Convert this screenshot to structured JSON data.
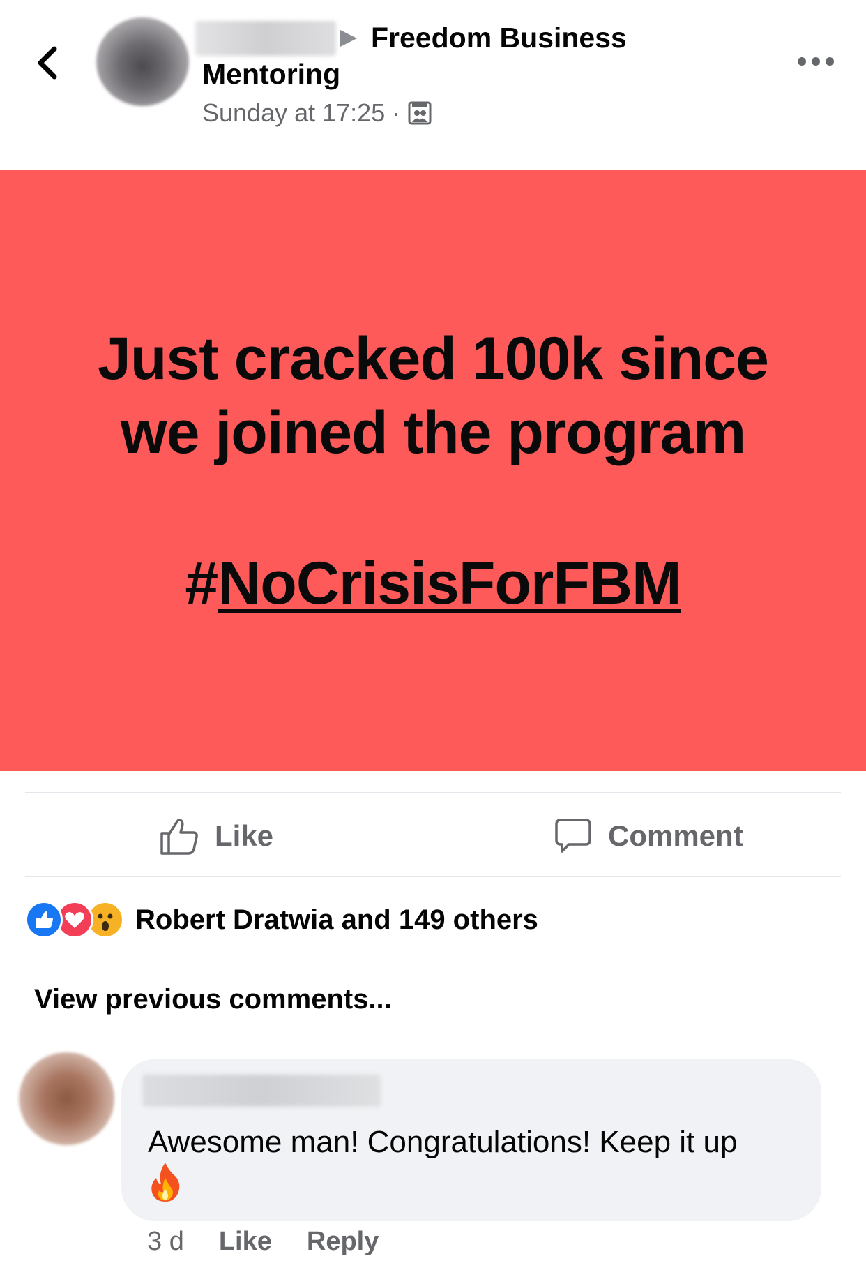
{
  "header": {
    "group_name": "Freedom Business Mentoring",
    "timestamp": "Sunday at 17:25",
    "separator": "·",
    "audience_icon": "group-icon",
    "back_icon": "chevron-left-icon",
    "more_icon": "more-horizontal-icon"
  },
  "post": {
    "background_color": "#ff5a5a",
    "line1": "Just cracked 100k since",
    "line2": "we joined the program",
    "hash_symbol": "#",
    "hashtag": "NoCrisisForFBM"
  },
  "actions": {
    "like_label": "Like",
    "comment_label": "Comment"
  },
  "reactions": {
    "icons": [
      "like-reaction-icon",
      "love-reaction-icon",
      "wow-reaction-icon"
    ],
    "summary": "Robert Dratwia and 149 others"
  },
  "comments": {
    "view_previous": "View previous comments...",
    "items": [
      {
        "text": "Awesome man! Congratulations! Keep it up",
        "emoji": "fire-icon",
        "age": "3 d",
        "like_label": "Like",
        "reply_label": "Reply"
      }
    ]
  }
}
